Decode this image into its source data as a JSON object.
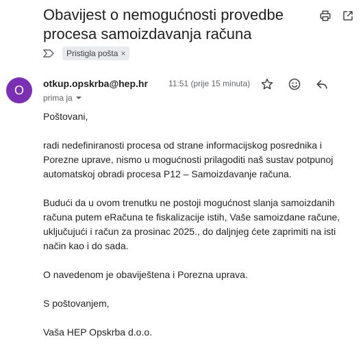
{
  "email": {
    "subject": "Obavijest o nemogućnosti provedbe procesa samoizdavanja računa",
    "label_chip": "Pristigla pošta",
    "label_chip_remove": "×",
    "sender_initial": "O",
    "sender": "otkup.opskrba@hep.hr",
    "time": "11:51 (prije 15 minuta)",
    "recipient": "prima ja",
    "body": {
      "greeting": "Poštovani,",
      "p1": "radi nedefiniranosti procesa od strane informacijskog posrednika i Porezne uprave, nismo u mogućnosti prilagoditi naš sustav potpunoj automatskoj obradi procesa P12 – Samoizdavanje računa.",
      "p2": "Budući da u ovom trenutku ne postoji mogućnost slanja samoizdanih računa putem eRačuna te fiskalizacije istih, Vaše samoizdane račune, uključujući i račun za prosinac 2025., do daljnjeg ćete zaprimiti na isti način kao i do sada.",
      "p3": "O navedenom je obaviještena i Porezna uprava.",
      "closing": "S poštovanjem,",
      "signature": "Vaša HEP Opskrba d.o.o."
    }
  },
  "icons": {
    "print": "print-icon",
    "open_new": "open-in-new-icon",
    "importance": "importance-marker-icon",
    "star": "star-icon",
    "emoji": "emoji-icon",
    "reply": "reply-icon",
    "dropdown": "chevron-down-icon"
  },
  "colors": {
    "avatar_bg": "#7b2fb5",
    "chip_bg": "#e8eaed"
  }
}
